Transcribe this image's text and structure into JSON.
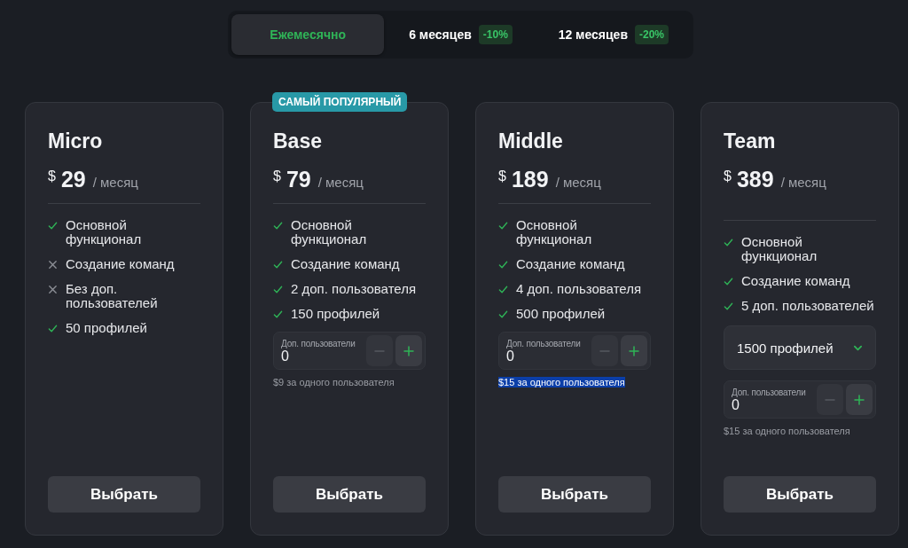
{
  "billing_tabs": [
    {
      "label": "Ежемесячно",
      "selected": true
    },
    {
      "label": "6 месяцев",
      "discount": "-10%",
      "selected": false
    },
    {
      "label": "12 месяцев",
      "discount": "-20%",
      "selected": false
    }
  ],
  "plans": [
    {
      "name": "Micro",
      "currency": "$",
      "price": "29",
      "period": "/ месяц",
      "features": [
        {
          "text": "Основной функционал",
          "included": true
        },
        {
          "text": "Создание команд",
          "included": false
        },
        {
          "text": "Без доп. пользователей",
          "included": false
        },
        {
          "text": "50 профилей",
          "included": true
        }
      ],
      "button": "Выбрать"
    },
    {
      "name": "Base",
      "badge": "САМЫЙ ПОПУЛЯРНЫЙ",
      "currency": "$",
      "price": "79",
      "period": "/ месяц",
      "features": [
        {
          "text": "Основной функционал",
          "included": true
        },
        {
          "text": "Создание команд",
          "included": true
        },
        {
          "text": "2 доп. пользователя",
          "included": true
        },
        {
          "text": "150 профилей",
          "included": true
        }
      ],
      "addon": {
        "label": "Доп. пользователи",
        "value": "0",
        "minus_disabled": true,
        "note": "$9 за одного пользователя",
        "note_selected": false
      },
      "button": "Выбрать"
    },
    {
      "name": "Middle",
      "currency": "$",
      "price": "189",
      "period": "/ месяц",
      "features": [
        {
          "text": "Основной функционал",
          "included": true
        },
        {
          "text": "Создание команд",
          "included": true
        },
        {
          "text": "4 доп. пользователя",
          "included": true
        },
        {
          "text": "500 профилей",
          "included": true
        }
      ],
      "addon": {
        "label": "Доп. пользователи",
        "value": "0",
        "minus_disabled": true,
        "note": "$15 за одного пользователя",
        "note_selected": true
      },
      "button": "Выбрать"
    },
    {
      "name": "Team",
      "currency": "$",
      "price": "389",
      "period": "/ месяц",
      "features": [
        {
          "text": "Основной функционал",
          "included": true
        },
        {
          "text": "Создание команд",
          "included": true
        },
        {
          "text": "5 доп. пользователей",
          "included": true
        }
      ],
      "dropdown": {
        "value": "1500 профилей"
      },
      "addon": {
        "label": "Доп. пользователи",
        "value": "0",
        "minus_disabled": true,
        "note": "$15 за одного пользователя",
        "note_selected": false
      },
      "button": "Выбрать"
    }
  ]
}
